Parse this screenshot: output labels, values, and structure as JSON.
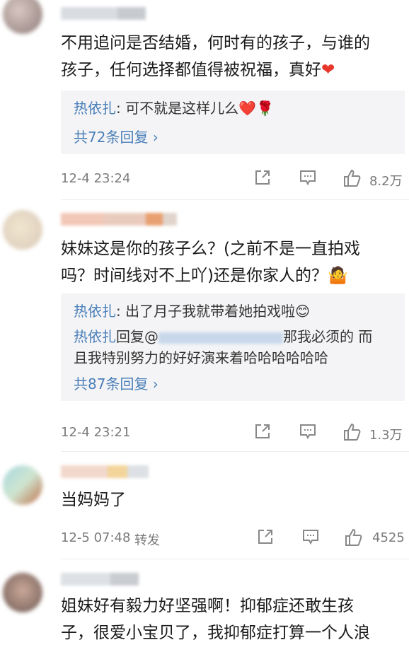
{
  "comments": [
    {
      "text": "不用追问是否结婚，何时有的孩子，与谁的孩子，任何选择都值得被祝福，真好❤️",
      "text_line1": "不用追问是否结婚，何时有的孩子，与谁的",
      "text_line2": "孩子，任何选择都值得被祝福，真好",
      "replies": [
        {
          "name": "热依扎",
          "text": ": 可不就是这样儿么❤️🌹"
        }
      ],
      "more_replies": "共72条回复 ›",
      "time": "12-4 23:24",
      "likes": "8.2万"
    },
    {
      "text": "妹妹这是你的孩子么？(之前不是一直拍戏吗？时间线对不上吖)还是你家人的？🤷",
      "text_line1": "妹妹这是你的孩子么？(之前不是一直拍戏",
      "text_line2": "吗？时间线对不上吖)还是你家人的？",
      "replies": [
        {
          "name": "热依扎",
          "text": ": 出了月子我就带着她拍戏啦😊"
        },
        {
          "name": "热依扎",
          "text_prefix": "回复@",
          "text_suffix": "那我必须的 而",
          "text_line2": "且我特别努力的好好演来着哈哈哈哈哈哈"
        }
      ],
      "more_replies": "共87条回复 ›",
      "time": "12-4 23:21",
      "likes": "1.3万"
    },
    {
      "text": "当妈妈了",
      "time": "12-5 07:48",
      "forward": "转发",
      "likes": "4525"
    },
    {
      "text_line1": "姐妹好有毅力好坚强啊！抑郁症还敢生孩",
      "text_line2": "子，很爱小宝贝了，我抑郁症打算一个人浪"
    }
  ],
  "icons": [
    "share-icon",
    "comment-icon",
    "like-icon"
  ],
  "colors": {
    "link": "#4a7fb8",
    "meta": "#7a7a7a",
    "reply_bg": "#f4f4f6",
    "heart": "#e8362b"
  }
}
